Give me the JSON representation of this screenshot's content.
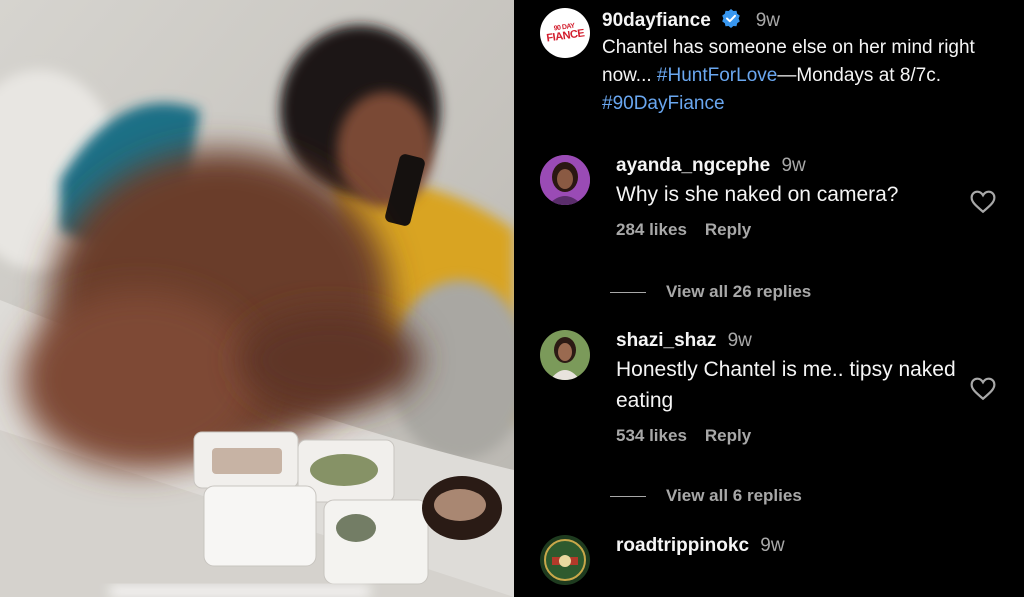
{
  "post": {
    "username": "90dayfiance",
    "verified": true,
    "time": "9w",
    "caption_text": "Chantel has someone else on her mind right now... ",
    "caption_tag1": "#HuntForLove",
    "caption_mid": "—Mondays at 8/7c. ",
    "caption_tag2": "#90DayFiance",
    "brand_logo_small": "90 DAY",
    "brand_logo_big": "FIANCE"
  },
  "comments": [
    {
      "username": "ayanda_ngcephe",
      "time": "9w",
      "text": "Why is she naked on camera?",
      "likes": "284 likes",
      "reply": "Reply",
      "view_replies": "View all 26 replies"
    },
    {
      "username": "shazi_shaz",
      "time": "9w",
      "text": "Honestly Chantel is me.. tipsy naked eating",
      "likes": "534 likes",
      "reply": "Reply",
      "view_replies": "View all 6 replies"
    },
    {
      "username": "roadtrippinokc",
      "time": "9w",
      "text": ""
    }
  ],
  "colors": {
    "background": "#000000",
    "hashtag": "#6aa7f0",
    "verified_badge": "#3897f0",
    "muted_text": "#a8a8a8",
    "brand_red": "#d21c2c"
  },
  "icons": {
    "verified": "verified-badge-icon",
    "like": "heart-outline-icon"
  }
}
